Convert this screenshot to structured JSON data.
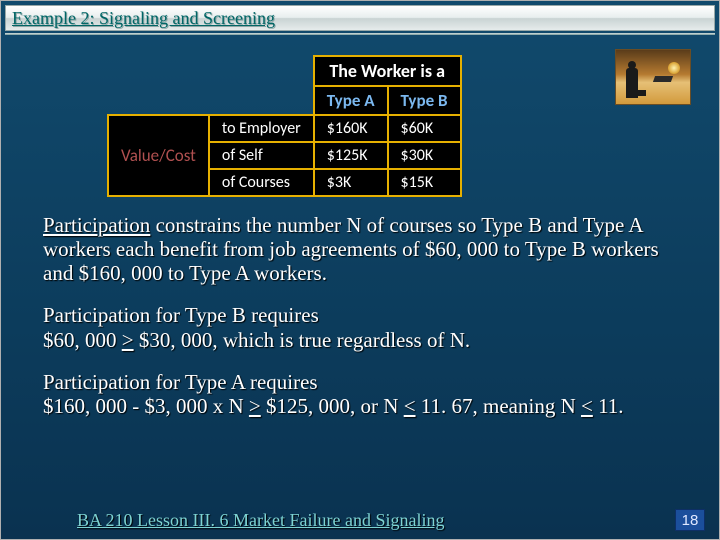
{
  "title": "Example 2: Signaling and Screening",
  "table": {
    "top_header": "The Worker is a",
    "col_a": "Type A",
    "col_b": "Type B",
    "side_header": "Value/Cost",
    "rows": [
      {
        "label": "to Employer",
        "a": "$160K",
        "b": "$60K"
      },
      {
        "label": "of Self",
        "a": "$125K",
        "b": "$30K"
      },
      {
        "label": "of Courses",
        "a": "$3K",
        "b": "$15K"
      }
    ]
  },
  "body": {
    "p1_a": "Participation",
    "p1_b": " constrains the number N of courses so Type B and Type A workers each benefit from job agreements of $60, 000 to Type B workers and $160, 000 to Type A workers.",
    "p2_a": "Participation for Type B requires",
    "p2_b": "$60, 000 ",
    "p2_ge": ">",
    "p2_c": " $30, 000, which is true regardless of N.",
    "p3_a": "Participation for Type A requires",
    "p3_b": "$160, 000 - $3, 000 x N ",
    "p3_ge1": ">",
    "p3_c": " $125, 000, or N ",
    "p3_le1": "<",
    "p3_d": " 11. 67, meaning N ",
    "p3_le2": "<",
    "p3_e": " 11."
  },
  "footer": {
    "course": "BA 210  Lesson III. 6 Market Failure and Signaling",
    "page": "18"
  }
}
